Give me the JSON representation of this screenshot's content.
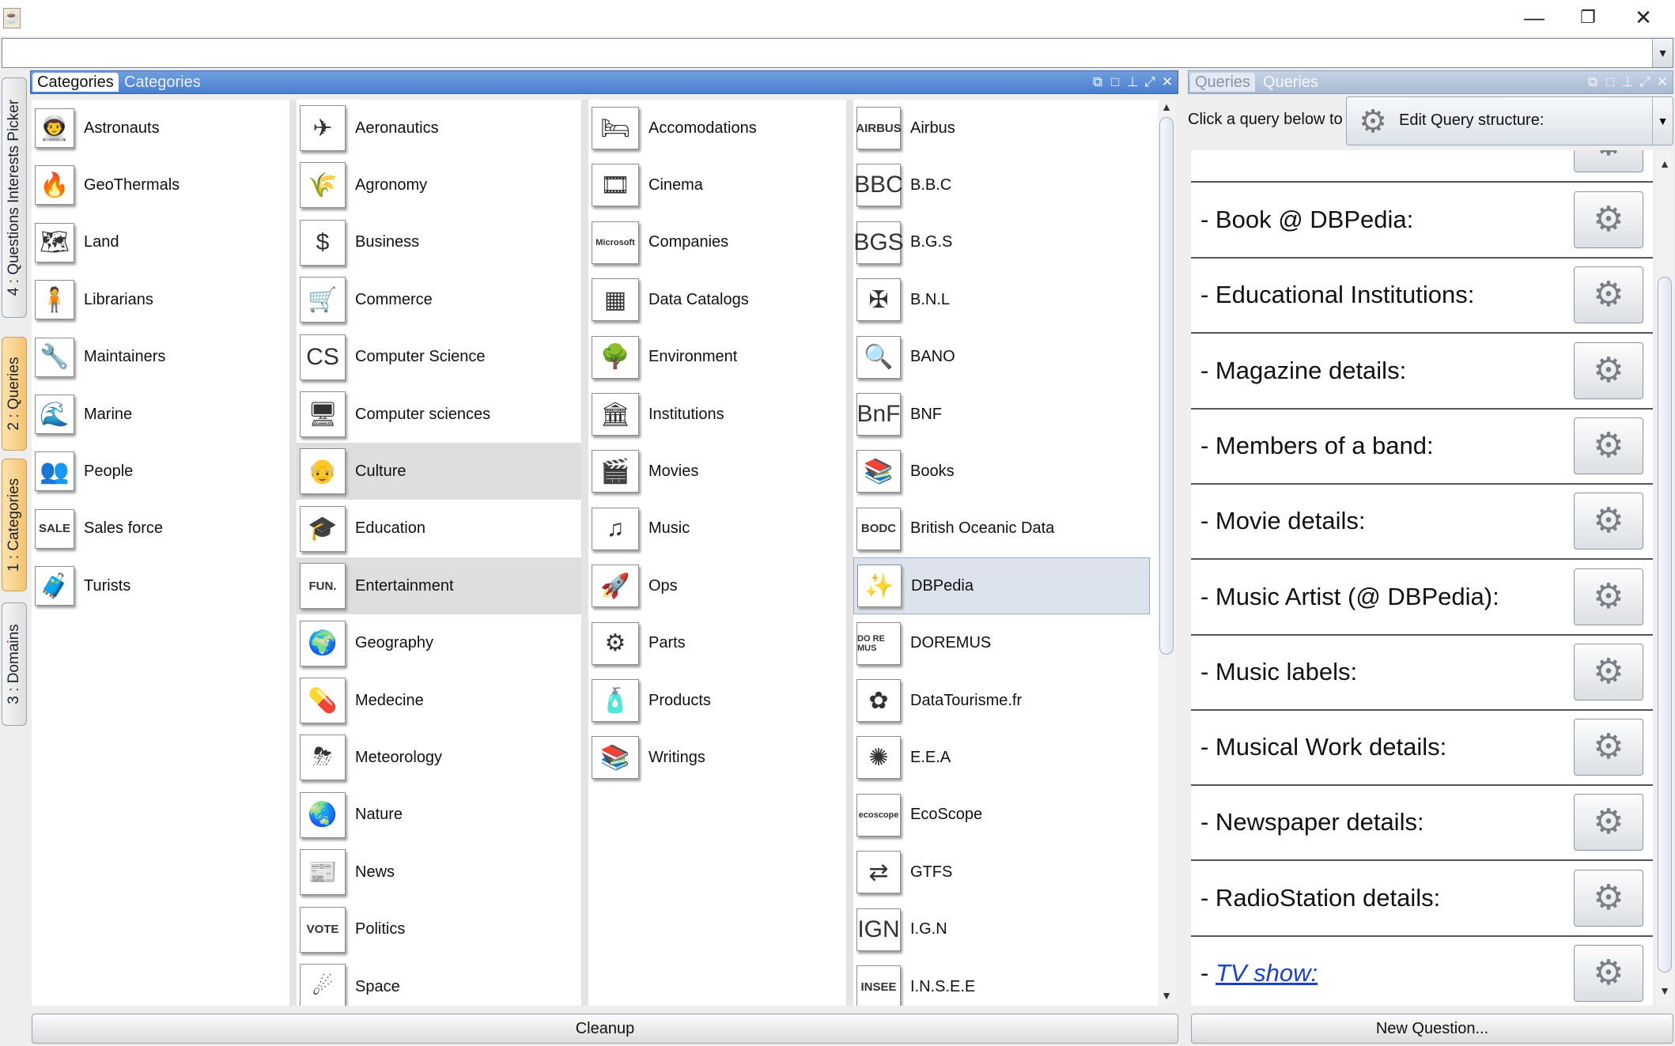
{
  "window": {
    "app_icon": "java-cup-icon",
    "controls": {
      "minimize": "—",
      "restore": "❐",
      "close": "✕"
    }
  },
  "top_combo": {
    "value": "",
    "arrow": "▼"
  },
  "side_tabs": [
    {
      "label": "4 : Questions Interests Picker",
      "active": false
    },
    {
      "label": "2 : Queries",
      "active": true
    },
    {
      "label": "1 : Categories",
      "active": true
    },
    {
      "label": "3 : Domains",
      "active": false
    }
  ],
  "categories_panel": {
    "tab_active": "Categories",
    "tab_inactive": "Categories",
    "columns": [
      [
        {
          "label": "Astronauts",
          "icon": "astronaut-icon",
          "glyph": "👨‍🚀"
        },
        {
          "label": "GeoThermals",
          "icon": "geothermal-icon",
          "glyph": "🔥"
        },
        {
          "label": "Land",
          "icon": "land-map-icon",
          "glyph": "🗺"
        },
        {
          "label": "Librarians",
          "icon": "librarian-icon",
          "glyph": "🧍"
        },
        {
          "label": "Maintainers",
          "icon": "maintainer-icon",
          "glyph": "🔧"
        },
        {
          "label": "Marine",
          "icon": "marine-icon",
          "glyph": "🌊"
        },
        {
          "label": "People",
          "icon": "people-icon",
          "glyph": "👥"
        },
        {
          "label": "Sales force",
          "icon": "sale-tag-icon",
          "glyph": "SALE"
        },
        {
          "label": "Turists",
          "icon": "tourist-icon",
          "glyph": "🧳"
        }
      ],
      [
        {
          "label": "Aeronautics",
          "icon": "airplane-icon",
          "glyph": "✈"
        },
        {
          "label": "Agronomy",
          "icon": "field-icon",
          "glyph": "🌾"
        },
        {
          "label": "Business",
          "icon": "dollar-icon",
          "glyph": "$"
        },
        {
          "label": "Commerce",
          "icon": "shopping-cart-icon",
          "glyph": "🛒"
        },
        {
          "label": "Computer Science",
          "icon": "terminal-icon",
          "glyph": "CS"
        },
        {
          "label": "Computer sciences",
          "icon": "computer-icon",
          "glyph": "🖥"
        },
        {
          "label": "Culture",
          "icon": "culture-portrait-icon",
          "glyph": "👴",
          "state": "selected"
        },
        {
          "label": "Education",
          "icon": "graduation-cap-icon",
          "glyph": "🎓"
        },
        {
          "label": "Entertainment",
          "icon": "fun-icon",
          "glyph": "FUN.",
          "state": "selected"
        },
        {
          "label": "Geography",
          "icon": "globe-icon",
          "glyph": "🌍"
        },
        {
          "label": "Medecine",
          "icon": "medicine-icon",
          "glyph": "💊"
        },
        {
          "label": "Meteorology",
          "icon": "storm-cloud-icon",
          "glyph": "⛈"
        },
        {
          "label": "Nature",
          "icon": "earth-icon",
          "glyph": "🌏"
        },
        {
          "label": "News",
          "icon": "newspaper-icon",
          "glyph": "📰"
        },
        {
          "label": "Politics",
          "icon": "vote-icon",
          "glyph": "VOTE"
        },
        {
          "label": "Space",
          "icon": "space-icon",
          "glyph": "☄"
        }
      ],
      [
        {
          "label": "Accomodations",
          "icon": "bed-icon",
          "glyph": "🛏"
        },
        {
          "label": "Cinema",
          "icon": "film-icon",
          "glyph": "🎞"
        },
        {
          "label": "Companies",
          "icon": "microsoft-logo-icon",
          "glyph": "Microsoft"
        },
        {
          "label": "Data Catalogs",
          "icon": "data-icon",
          "glyph": "▦"
        },
        {
          "label": "Environment",
          "icon": "tree-icon",
          "glyph": "🌳"
        },
        {
          "label": "Institutions",
          "icon": "institution-icon",
          "glyph": "🏛"
        },
        {
          "label": "Movies",
          "icon": "movie-reel-icon",
          "glyph": "🎬"
        },
        {
          "label": "Music",
          "icon": "music-note-icon",
          "glyph": "♫"
        },
        {
          "label": "Ops",
          "icon": "space-shuttle-icon",
          "glyph": "🚀"
        },
        {
          "label": "Parts",
          "icon": "gears-icon",
          "glyph": "⚙"
        },
        {
          "label": "Products",
          "icon": "bottles-icon",
          "glyph": "🧴"
        },
        {
          "label": "Writings",
          "icon": "books-stack-icon",
          "glyph": "📚"
        }
      ],
      [
        {
          "label": "Airbus",
          "icon": "airbus-logo-icon",
          "glyph": "AIRBUS"
        },
        {
          "label": "B.B.C",
          "icon": "bbc-logo-icon",
          "glyph": "BBC"
        },
        {
          "label": "B.G.S",
          "icon": "bgs-logo-icon",
          "glyph": "BGS"
        },
        {
          "label": "B.N.L",
          "icon": "union-jack-icon",
          "glyph": "✠"
        },
        {
          "label": "BANO",
          "icon": "magnifier-icon",
          "glyph": "🔍"
        },
        {
          "label": "BNF",
          "icon": "bnf-logo-icon",
          "glyph": "BnF"
        },
        {
          "label": "Books",
          "icon": "books-icon",
          "glyph": "📚"
        },
        {
          "label": "British Oceanic Data",
          "icon": "bodc-logo-icon",
          "glyph": "BODC"
        },
        {
          "label": "DBPedia",
          "icon": "dbpedia-stars-icon",
          "glyph": "✨",
          "state": "highlight"
        },
        {
          "label": "DOREMUS",
          "icon": "doremus-logo-icon",
          "glyph": "DO RE MUS"
        },
        {
          "label": "DataTourisme.fr",
          "icon": "datatourisme-logo-icon",
          "glyph": "✿"
        },
        {
          "label": "E.E.A",
          "icon": "eea-logo-icon",
          "glyph": "✺"
        },
        {
          "label": "EcoScope",
          "icon": "ecoscope-logo-icon",
          "glyph": "ecoscope"
        },
        {
          "label": "GTFS",
          "icon": "gtfs-logo-icon",
          "glyph": "⇄"
        },
        {
          "label": "I.G.N",
          "icon": "ign-logo-icon",
          "glyph": "IGN"
        },
        {
          "label": "I.N.S.E.E",
          "icon": "insee-logo-icon",
          "glyph": "INSEE"
        }
      ]
    ],
    "cleanup_button": "Cleanup"
  },
  "queries_panel": {
    "tab_active": "Queries",
    "tab_inactive": "Queries",
    "click_label": "Click a query below to :",
    "action_combo": {
      "value": "Edit Query structure:",
      "icon": "gear-pencil-icon"
    },
    "items": [
      {
        "text": "- Book @ DBPedia:",
        "link": false
      },
      {
        "text": "- Educational Institutions:",
        "link": false
      },
      {
        "text": "- Magazine details:",
        "link": false
      },
      {
        "text": "- Members of a band:",
        "link": false
      },
      {
        "text": "- Movie details:",
        "link": false
      },
      {
        "text": "- Music Artist (@ DBPedia):",
        "link": false
      },
      {
        "text": "- Music labels:",
        "link": false
      },
      {
        "text": "- Musical Work details:",
        "link": false
      },
      {
        "text": "- Newspaper details:",
        "link": false
      },
      {
        "text": "- RadioStation details:",
        "link": false
      },
      {
        "text": "TV show:",
        "prefix": "- ",
        "link": true
      }
    ],
    "edit_glyph": "⚙",
    "new_question_button": "New Question..."
  }
}
